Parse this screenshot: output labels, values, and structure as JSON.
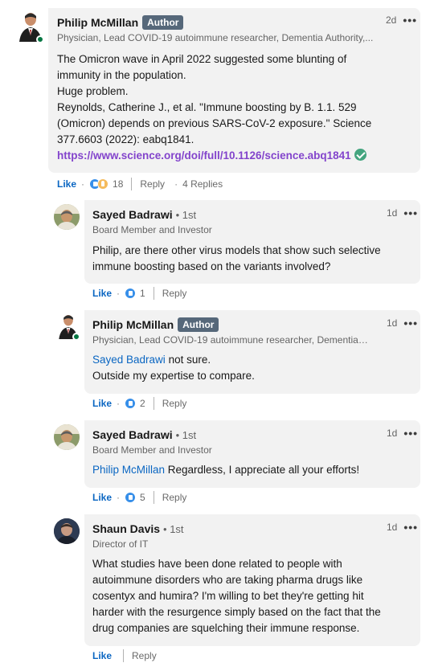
{
  "comments": [
    {
      "name": "Philip McMillan",
      "badge": "Author",
      "headline": "Physician, Lead COVID-19 autoimmune researcher, Dementia Authority,...",
      "time": "2d",
      "body_lines": [
        "The Omicron wave in April 2022 suggested some blunting of",
        "immunity in the population.",
        "Huge problem.",
        "Reynolds, Catherine J., et al. \"Immune boosting by B. 1.1. 529",
        "(Omicron) depends on previous SARS-CoV-2 exposure.\" Science",
        "377.6603 (2022): eabq1841."
      ],
      "link": "https://www.science.org/doi/full/10.1126/science.abq1841",
      "like_label": "Like",
      "reaction_count": "18",
      "reply_label": "Reply",
      "replies_label": "4 Replies"
    },
    {
      "name": "Sayed Badrawi",
      "degree": "• 1st",
      "headline": "Board Member and Investor",
      "time": "1d",
      "body_lines": [
        "Philip, are there other virus models that show such selective",
        "immune boosting based on the variants involved?"
      ],
      "like_label": "Like",
      "reaction_count": "1",
      "reply_label": "Reply"
    },
    {
      "name": "Philip McMillan",
      "badge": "Author",
      "headline": "Physician, Lead COVID-19 autoimmune researcher, Dementia A...",
      "time": "1d",
      "mention": "Sayed Badrawi",
      "mention_rest": " not sure.",
      "body_line2": "Outside my expertise to compare.",
      "like_label": "Like",
      "reaction_count": "2",
      "reply_label": "Reply"
    },
    {
      "name": "Sayed Badrawi",
      "degree": "• 1st",
      "headline": "Board Member and Investor",
      "time": "1d",
      "mention": "Philip McMillan",
      "mention_rest": " Regardless, I appreciate all your efforts!",
      "like_label": "Like",
      "reaction_count": "5",
      "reply_label": "Reply"
    },
    {
      "name": "Shaun Davis",
      "degree": "• 1st",
      "headline": "Director of IT",
      "time": "1d",
      "body_lines": [
        "What studies have been done related to people with",
        "autoimmune disorders who are taking pharma drugs like",
        "cosentyx and humira? I'm willing to bet they're getting hit",
        "harder with the resurgence simply based on the fact that the",
        "drug companies are squelching their immune response."
      ],
      "like_label": "Like",
      "reply_label": "Reply"
    }
  ],
  "more_icon": "more-horizontal-icon",
  "colors": {
    "bubble": "#f2f2f2",
    "link_blue": "#0a66c2",
    "link_purple": "#8344cc",
    "badge_bg": "#56687a",
    "verified_green": "#44a57f"
  }
}
